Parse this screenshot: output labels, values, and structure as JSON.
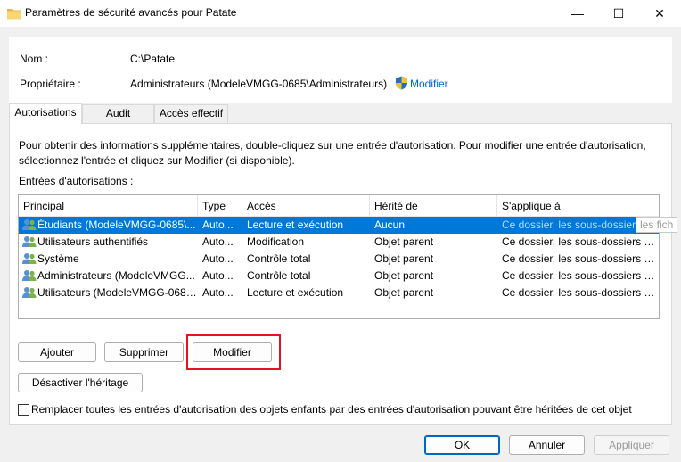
{
  "window": {
    "title": "Paramètres de sécurité avancés pour Patate",
    "controls": {
      "minimize": "—",
      "maximize": "☐",
      "close": "✕"
    }
  },
  "info": {
    "nom_label": "Nom :",
    "nom_value": "C:\\Patate",
    "proprietaire_label": "Propriétaire :",
    "proprietaire_value": "Administrateurs (ModeleVMGG-0685\\Administrateurs)",
    "modifier_link": "Modifier"
  },
  "tabs": [
    {
      "label": "Autorisations",
      "active": true
    },
    {
      "label": "Audit",
      "active": false
    },
    {
      "label": "Accès effectif",
      "active": false
    }
  ],
  "panel": {
    "description": "Pour obtenir des informations supplémentaires, double-cliquez sur une entrée d'autorisation. Pour modifier une entrée d'autorisation, sélectionnez l'entrée et cliquez sur Modifier (si disponible).",
    "entries_label": "Entrées d'autorisations :"
  },
  "table": {
    "columns": [
      "Principal",
      "Type",
      "Accès",
      "Hérité de",
      "S'applique à"
    ],
    "rows": [
      {
        "principal": "Étudiants (ModeleVMGG-0685\\...",
        "type": "Auto...",
        "acces": "Lecture et exécution",
        "herite": "Aucun",
        "applique": "Ce dossier, les sous-dossiers et...",
        "selected": true
      },
      {
        "principal": "Utilisateurs authentifiés",
        "type": "Auto...",
        "acces": "Modification",
        "herite": "Objet parent",
        "applique": "Ce dossier, les sous-dossiers et...",
        "selected": false
      },
      {
        "principal": "Système",
        "type": "Auto...",
        "acces": "Contrôle total",
        "herite": "Objet parent",
        "applique": "Ce dossier, les sous-dossiers et...",
        "selected": false
      },
      {
        "principal": "Administrateurs (ModeleVMGG...",
        "type": "Auto...",
        "acces": "Contrôle total",
        "herite": "Objet parent",
        "applique": "Ce dossier, les sous-dossiers et...",
        "selected": false
      },
      {
        "principal": "Utilisateurs (ModeleVMGG-0685...",
        "type": "Auto...",
        "acces": "Lecture et exécution",
        "herite": "Objet parent",
        "applique": "Ce dossier, les sous-dossiers et...",
        "selected": false
      }
    ],
    "tooltip": "les fich"
  },
  "buttons": {
    "ajouter": "Ajouter",
    "supprimer": "Supprimer",
    "modifier": "Modifier",
    "desactiver": "Désactiver l'héritage"
  },
  "checkbox": {
    "label": "Remplacer toutes les entrées d'autorisation des objets enfants par des entrées d'autorisation pouvant être héritées de cet objet",
    "checked": false
  },
  "footer": {
    "ok": "OK",
    "annuler": "Annuler",
    "appliquer": "Appliquer"
  },
  "colors": {
    "selection": "#0078d7",
    "link": "#0066cc",
    "highlight_box": "#e81123"
  },
  "icons": {
    "folder": "folder-icon",
    "shield": "uac-shield-icon",
    "users": "users-icon"
  }
}
